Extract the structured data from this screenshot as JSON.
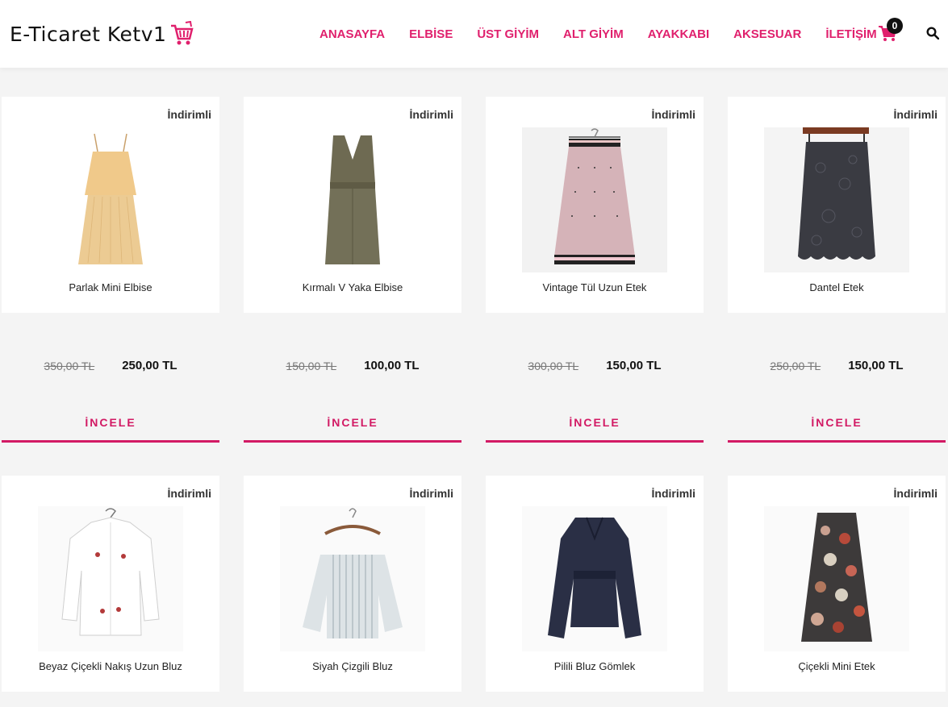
{
  "header": {
    "logo_text": "E-Ticaret Ketv1",
    "nav": [
      "ANASAYFA",
      "ELBİSE",
      "ÜST GİYİM",
      "ALT GİYİM",
      "AYAKKABI",
      "AKSESUAR",
      "İLETİŞİM"
    ],
    "cart_count": "0",
    "accent_color": "#e0206d"
  },
  "products": [
    {
      "badge": "İndirimli",
      "name": "Parlak Mini Elbise",
      "old_price": "350,00 TL",
      "price": "250,00 TL",
      "button": "İNCELE",
      "image": "dress-icon"
    },
    {
      "badge": "İndirimli",
      "name": "Kırmalı V Yaka Elbise",
      "old_price": "150,00 TL",
      "price": "100,00 TL",
      "button": "İNCELE",
      "image": "dress-icon"
    },
    {
      "badge": "İndirimli",
      "name": "Vintage Tül Uzun Etek",
      "old_price": "300,00 TL",
      "price": "150,00 TL",
      "button": "İNCELE",
      "image": "skirt-icon"
    },
    {
      "badge": "İndirimli",
      "name": "Dantel Etek",
      "old_price": "250,00 TL",
      "price": "150,00 TL",
      "button": "İNCELE",
      "image": "skirt-icon"
    },
    {
      "badge": "İndirimli",
      "name": "Beyaz Çiçekli Nakış Uzun Bluz",
      "image": "shirt-icon"
    },
    {
      "badge": "İndirimli",
      "name": "Siyah Çizgili Bluz",
      "image": "blouse-icon"
    },
    {
      "badge": "İndirimli",
      "name": "Pilili Bluz Gömlek",
      "image": "blouse-icon"
    },
    {
      "badge": "İndirimli",
      "name": "Çiçekli Mini Etek",
      "image": "skirt-icon"
    }
  ]
}
